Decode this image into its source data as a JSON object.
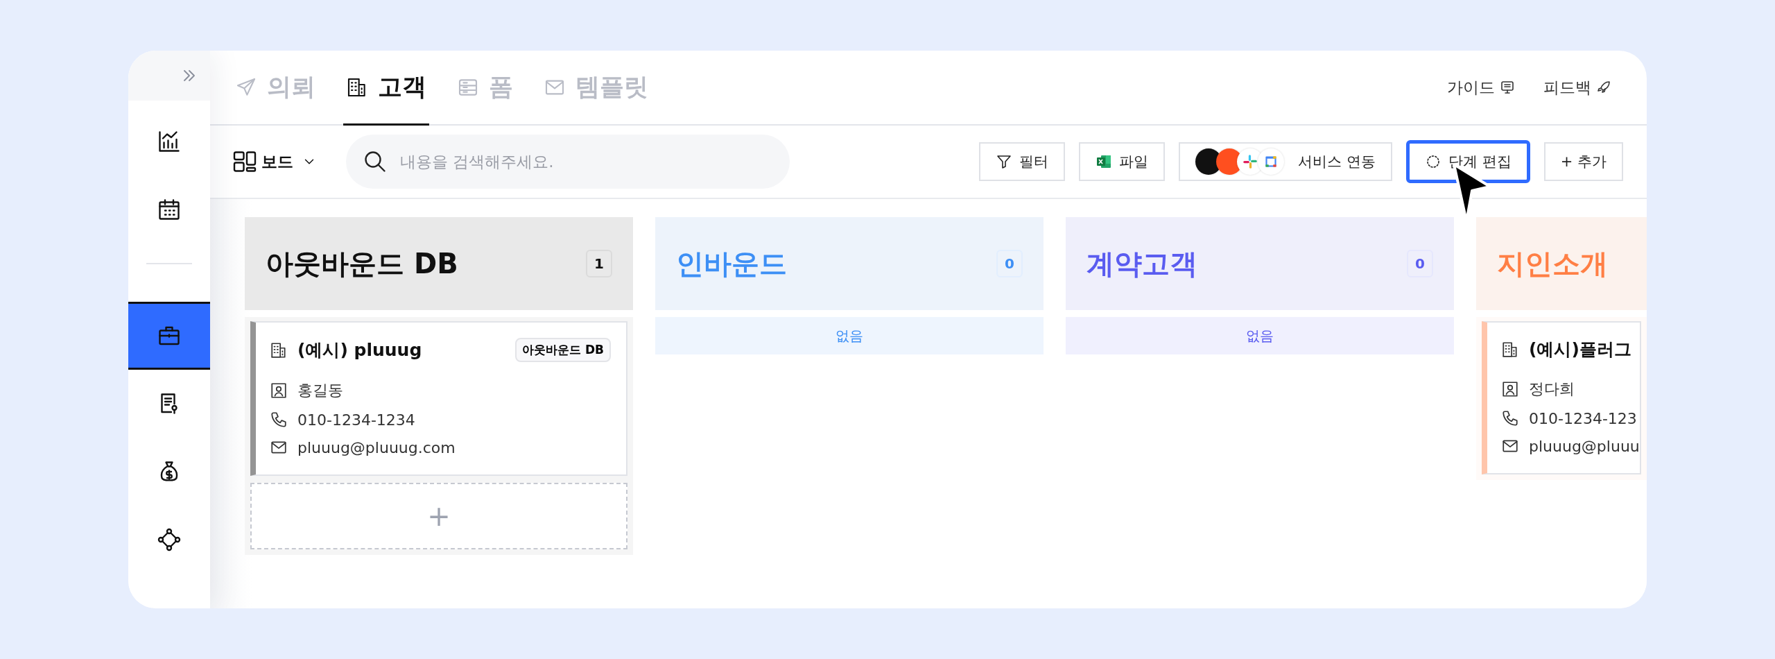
{
  "sidebar": {
    "items": [
      {
        "selected": false
      },
      {
        "selected": false
      },
      {
        "selected": true
      },
      {
        "selected": false
      },
      {
        "selected": false
      },
      {
        "selected": false
      }
    ]
  },
  "tabs": [
    {
      "label": "의뢰",
      "selected": false
    },
    {
      "label": "고객",
      "selected": true
    },
    {
      "label": "폼",
      "selected": false
    },
    {
      "label": "템플릿",
      "selected": false
    }
  ],
  "header_links": [
    {
      "label": "가이드"
    },
    {
      "label": "피드백"
    }
  ],
  "toolbar": {
    "view": "보드",
    "search": {
      "placeholder": "내용을 검색해주세요."
    },
    "buttons": [
      {
        "kind": "filter",
        "label": "필터",
        "highlighted": false
      },
      {
        "kind": "excel",
        "label": "파일",
        "highlighted": false
      },
      {
        "kind": "services",
        "label": "서비스 연동",
        "highlighted": false
      },
      {
        "kind": "stages",
        "label": "단계 편집",
        "highlighted": true
      },
      {
        "kind": "add",
        "label": "+ 추가",
        "highlighted": false
      }
    ]
  },
  "columns": [
    {
      "title": "아웃바운드 DB",
      "count": "1",
      "color": "#111111",
      "cards": [
        {
          "name": "(예시) pluuug",
          "tag": "아웃바운드 DB",
          "contact": "홍길동",
          "phone": "010-1234-1234",
          "email": "pluuug@pluuug.com"
        }
      ],
      "add_label": "+"
    },
    {
      "title": "인바운드",
      "count": "0",
      "color": "#3d8ff5",
      "empty": "없음"
    },
    {
      "title": "계약고객",
      "count": "0",
      "color": "#5a5cf0",
      "empty": "없음"
    },
    {
      "title": "지인소개",
      "color": "#ff7f45",
      "cards": [
        {
          "name": "(예시)플러그",
          "contact": "정다희",
          "phone": "010-1234-123",
          "email": "pluuug@pluuu"
        }
      ]
    }
  ]
}
